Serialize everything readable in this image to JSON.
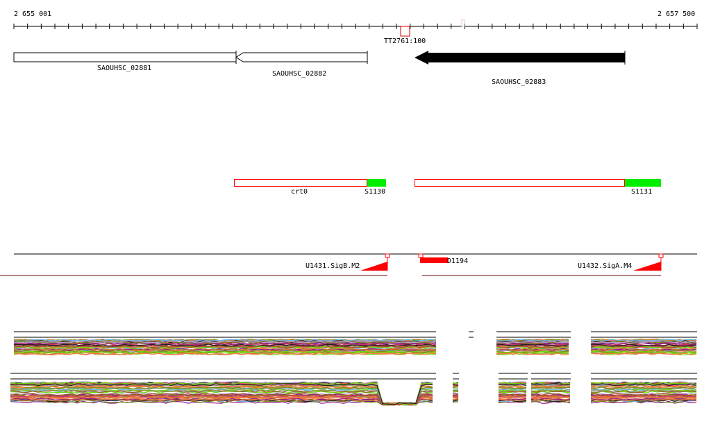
{
  "ruler": {
    "start": "2 655 001",
    "end": "2 657 500"
  },
  "terminator": {
    "label": "TT2761:100"
  },
  "genes": [
    {
      "label": "SAOUHSC_02881",
      "strand": "-",
      "style": "outline"
    },
    {
      "label": "SAOUHSC_02882",
      "strand": "-",
      "style": "outline"
    },
    {
      "label": "SAOUHSC_02883",
      "strand": "-",
      "style": "filled"
    }
  ],
  "segments": [
    {
      "label": "crt0"
    },
    {
      "label": "S1130"
    },
    {
      "label": "S1131"
    }
  ],
  "promoters": [
    {
      "label": "U1431.SigB.M2"
    },
    {
      "label": "D1194"
    },
    {
      "label": "U1432.SigA.M4"
    }
  ],
  "colors": {
    "segment_outline": "#ff0000",
    "segment_fill": "#00ee00",
    "promoter": "#ff0000",
    "gene_filled": "#000000"
  }
}
